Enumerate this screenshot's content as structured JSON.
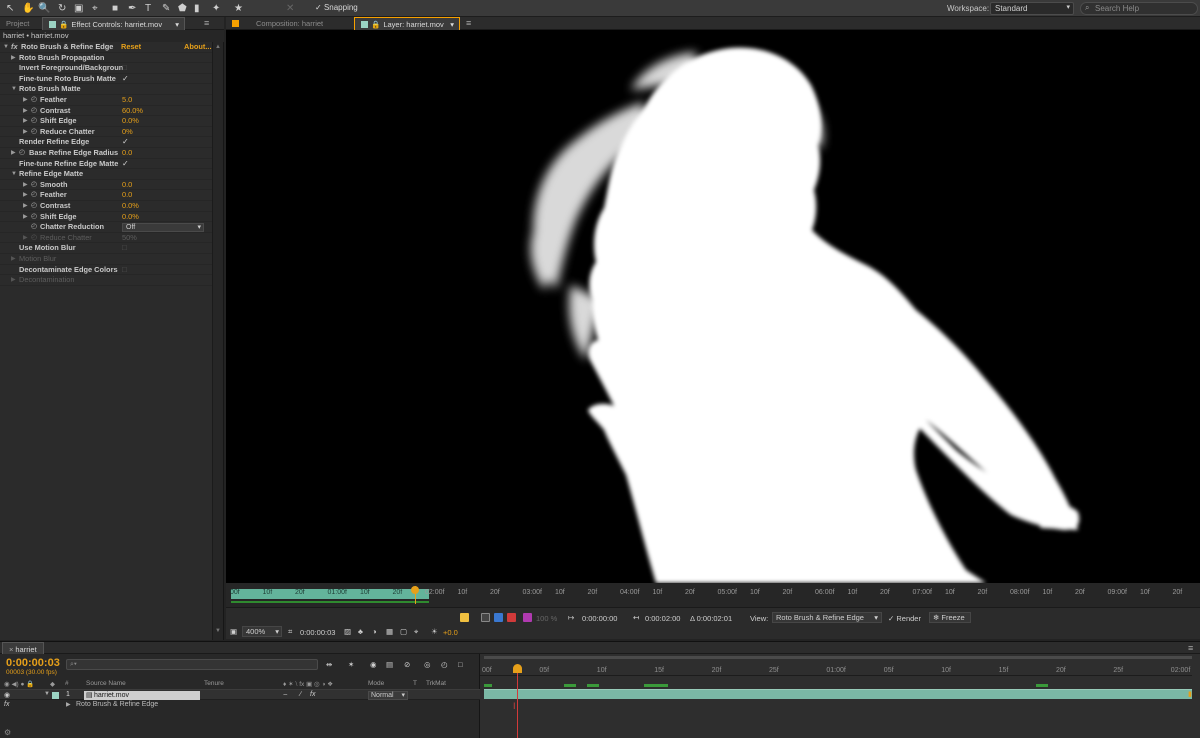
{
  "toolbar": {
    "snapping": "Snapping",
    "workspace_label": "Workspace:",
    "workspace_value": "Standard",
    "search_placeholder": "Search Help"
  },
  "left_tabs": {
    "project": "Project",
    "effect_controls": "Effect Controls: harriet.mov"
  },
  "viewer_tabs": {
    "composition": "Composition: harriet",
    "layer": "Layer: harriet.mov"
  },
  "effect_controls": {
    "header": "harriet • harriet.mov",
    "effect_name": "Roto Brush & Refine Edge",
    "reset": "Reset",
    "about": "About...",
    "rows": {
      "propagation": "Roto Brush Propagation",
      "invert": "Invert Foreground/Backgroun",
      "finetune_roto": "Fine-tune Roto Brush Matte",
      "roto_matte": "Roto Brush Matte",
      "feather": "Feather",
      "feather_val": "5.0",
      "contrast": "Contrast",
      "contrast_val": "60.0%",
      "shift_edge": "Shift Edge",
      "shift_edge_val": "0.0%",
      "reduce_chatter": "Reduce Chatter",
      "reduce_chatter_val": "0%",
      "render_refine": "Render Refine Edge",
      "base_radius": "Base Refine Edge Radius",
      "base_radius_val": "0.0",
      "finetune_refine": "Fine-tune Refine Edge Matte",
      "refine_matte": "Refine Edge Matte",
      "smooth": "Smooth",
      "smooth_val": "0.0",
      "feather2": "Feather",
      "feather2_val": "0.0",
      "contrast2": "Contrast",
      "contrast2_val": "0.0%",
      "shift_edge2": "Shift Edge",
      "shift_edge2_val": "0.0%",
      "chatter_reduction": "Chatter Reduction",
      "chatter_reduction_val": "Off",
      "reduce_chatter2": "Reduce Chatter",
      "reduce_chatter2_val": "50%",
      "motion_blur": "Use Motion Blur",
      "motion_blur2": "Motion Blur",
      "decontam_colors": "Decontaminate Edge Colors",
      "decontamination": "Decontamination"
    }
  },
  "mini_timeline": {
    "ticks": [
      "00f",
      "10f",
      "20f",
      "01:00f",
      "10f",
      "20f",
      "02:00f",
      "10f",
      "20f",
      "03:00f",
      "10f",
      "20f",
      "04:00f",
      "10f",
      "20f",
      "05:00f",
      "10f",
      "20f",
      "06:00f",
      "10f",
      "20f",
      "07:00f",
      "10f",
      "20f",
      "08:00f",
      "10f",
      "20f",
      "09:00f",
      "10f",
      "20f"
    ],
    "colors": {
      "range": "#63b49b",
      "cti": "#e6a01a"
    }
  },
  "viewer_controls": {
    "time_in": "0:00:00:00",
    "time_out": "0:00:02:00",
    "duration": "Δ 0:00:02:01",
    "view_label": "View:",
    "view_value": "Roto Brush & Refine Edge",
    "render": "Render",
    "freeze": "Freeze",
    "zoom": "400%",
    "current_time": "0:00:00:03",
    "exposure": "+0.0",
    "opacity": "100 %"
  },
  "timeline": {
    "tab": "harriet",
    "timecode": "0:00:00:03",
    "fps": "00003 (30.00 fps)",
    "headers": {
      "source_name": "Source Name",
      "tenure": "Tenure",
      "mode": "Mode",
      "t": "T",
      "trkmat": "TrkMat"
    },
    "layer": {
      "index": "1",
      "name": "harriet.mov",
      "mode": "Normal"
    },
    "effect_label": "Roto Brush & Refine Edge",
    "fx_label": "fx",
    "ticks": [
      "00f",
      "05f",
      "10f",
      "15f",
      "20f",
      "25f",
      "01:00f",
      "05f",
      "10f",
      "15f",
      "20f",
      "25f",
      "02:00f"
    ],
    "colors": {
      "layer_bar": "#7ab8a5",
      "cti": "#d23a3a",
      "accent": "#e6a01a"
    }
  }
}
